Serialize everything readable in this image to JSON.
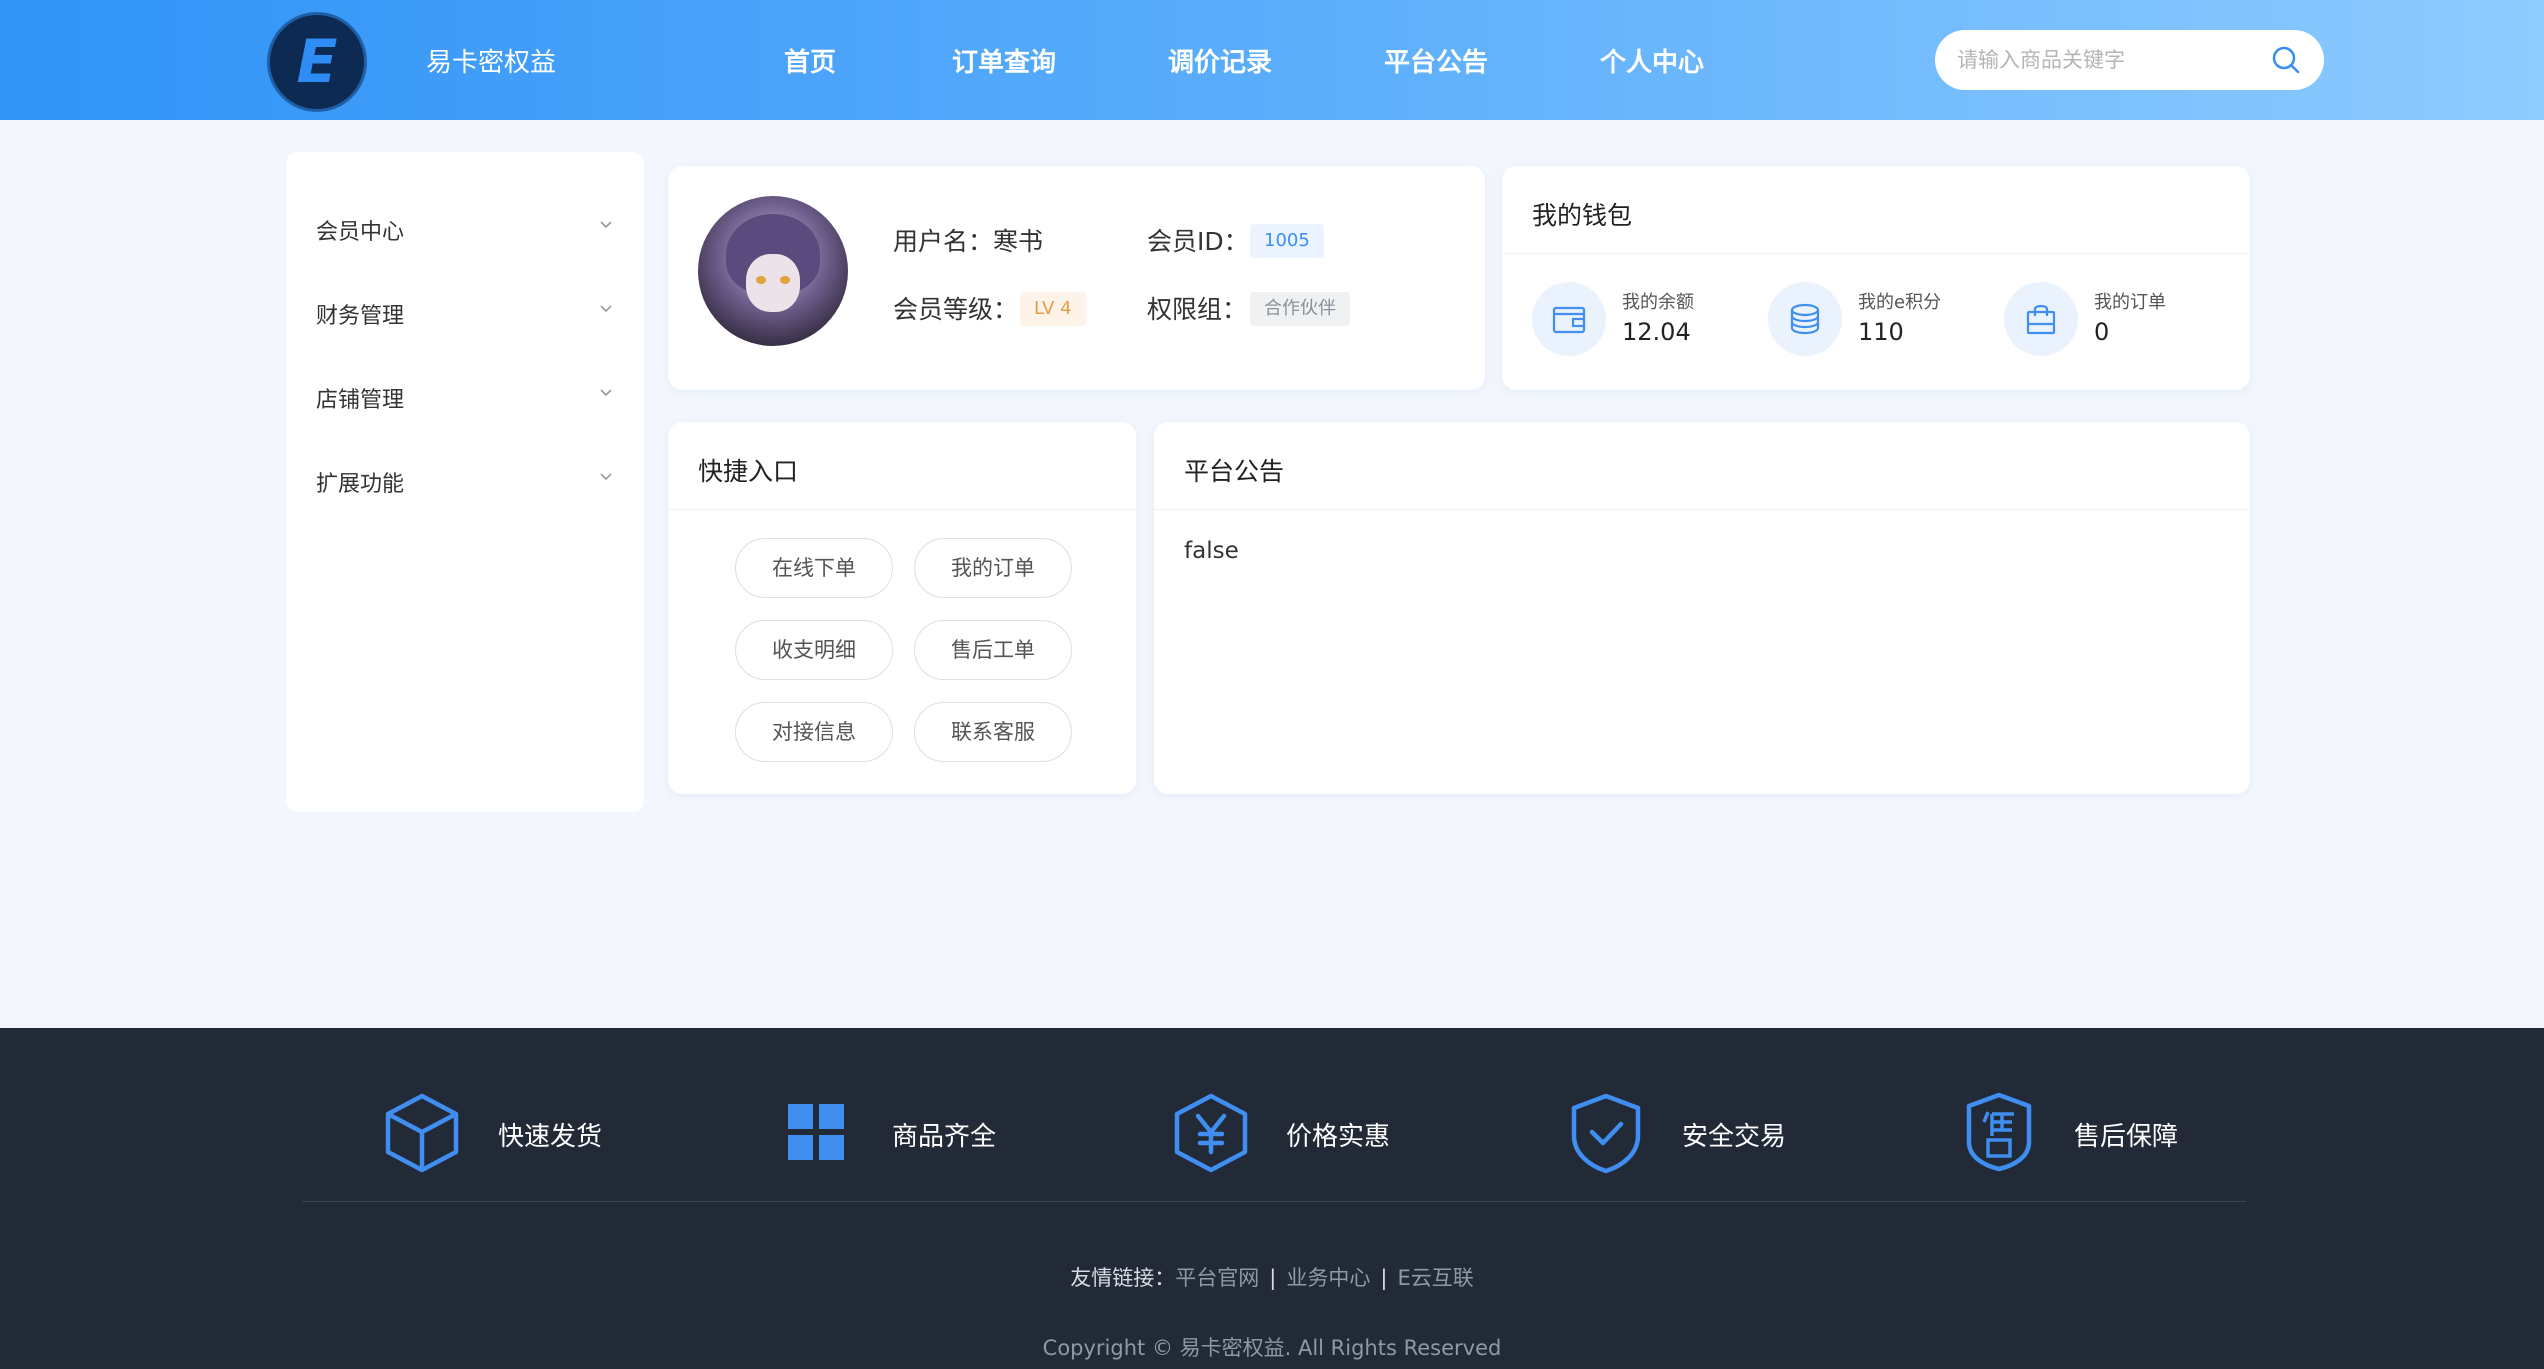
{
  "header": {
    "logo_letter": "E",
    "brand": "易卡密权益",
    "nav": [
      "首页",
      "订单查询",
      "调价记录",
      "平台公告",
      "个人中心"
    ],
    "search_placeholder": "请输入商品关键字"
  },
  "sidebar": {
    "items": [
      {
        "label": "会员中心"
      },
      {
        "label": "财务管理"
      },
      {
        "label": "店铺管理"
      },
      {
        "label": "扩展功能"
      }
    ]
  },
  "profile": {
    "username_label": "用户名：寒书",
    "member_id_label": "会员ID：",
    "member_id": "1005",
    "level_label": "会员等级：",
    "level": "LV 4",
    "group_label": "权限组：",
    "group": "合作伙伴"
  },
  "wallet": {
    "title": "我的钱包",
    "items": [
      {
        "label": "我的余额",
        "value": "12.04",
        "icon": "wallet-icon"
      },
      {
        "label": "我的e积分",
        "value": "110",
        "icon": "coins-icon"
      },
      {
        "label": "我的订单",
        "value": "0",
        "icon": "bag-icon"
      }
    ]
  },
  "quick": {
    "title": "快捷入口",
    "buttons": [
      "在线下单",
      "我的订单",
      "收支明细",
      "售后工单",
      "对接信息",
      "联系客服"
    ]
  },
  "notice": {
    "title": "平台公告",
    "content": "false"
  },
  "footer": {
    "features": [
      {
        "label": "快速发货",
        "icon": "box-icon"
      },
      {
        "label": "商品齐全",
        "icon": "grid-icon"
      },
      {
        "label": "价格实惠",
        "icon": "yen-icon"
      },
      {
        "label": "安全交易",
        "icon": "shield-check-icon"
      },
      {
        "label": "售后保障",
        "icon": "after-sale-icon"
      }
    ],
    "links_lead": "友情链接：",
    "links": [
      "平台官网",
      "业务中心",
      "E云互联"
    ],
    "copyright": "Copyright © 易卡密权益. All Rights Reserved"
  },
  "colors": {
    "accent": "#3b8ff2",
    "footer_bg": "#222a38",
    "icon_blue": "#3f8ef0"
  }
}
